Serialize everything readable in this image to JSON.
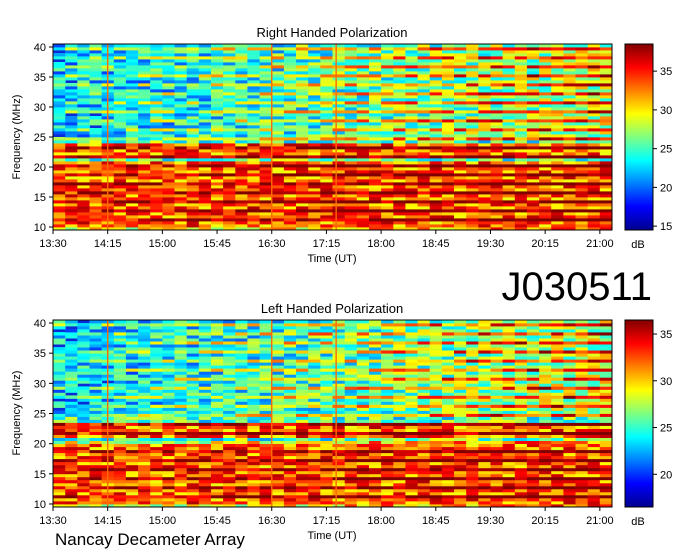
{
  "figure": {
    "label": "J030511",
    "footer": "Nancay Decameter Array"
  },
  "colorbar_unit": "dB",
  "chart_data": [
    {
      "type": "heatmap",
      "title": "Right Handed Polarization",
      "xlabel": "Time (UT)",
      "ylabel": "Frequency (MHz)",
      "x_ticks": [
        "13:30",
        "14:15",
        "15:00",
        "15:45",
        "16:30",
        "17:15",
        "18:00",
        "18:45",
        "19:30",
        "20:15",
        "21:00"
      ],
      "xlim": [
        "13:30",
        "21:10"
      ],
      "y_ticks": [
        10,
        15,
        20,
        25,
        30,
        35,
        40
      ],
      "ylim": [
        9.5,
        40.5
      ],
      "colorbar": {
        "unit": "dB",
        "ticks": [
          15,
          20,
          25,
          30,
          35
        ],
        "range": [
          14.5,
          38.5
        ],
        "colormap": "jet"
      },
      "strong_emission_bands_mhz": [
        [
          10,
          20.5
        ],
        [
          21.5,
          23.5
        ]
      ],
      "event_markers_ut": [
        "14:15",
        "16:30",
        "17:23"
      ]
    },
    {
      "type": "heatmap",
      "title": "Left Handed Polarization",
      "xlabel": "Time (UT)",
      "ylabel": "Frequency (MHz)",
      "x_ticks": [
        "13:30",
        "14:15",
        "15:00",
        "15:45",
        "16:30",
        "17:15",
        "18:00",
        "18:45",
        "19:30",
        "20:15",
        "21:00"
      ],
      "xlim": [
        "13:30",
        "21:10"
      ],
      "y_ticks": [
        10,
        15,
        20,
        25,
        30,
        35,
        40
      ],
      "ylim": [
        9.5,
        40.5
      ],
      "colorbar": {
        "unit": "dB",
        "ticks": [
          20,
          25,
          30,
          35
        ],
        "range": [
          16.5,
          36.5
        ],
        "colormap": "jet"
      },
      "strong_emission_bands_mhz": [
        [
          10,
          19.5
        ],
        [
          21,
          23
        ]
      ],
      "event_markers_ut": [
        "14:15",
        "16:30",
        "17:23"
      ]
    }
  ],
  "colors": {
    "axis": "#000000",
    "background": "#ffffff"
  }
}
